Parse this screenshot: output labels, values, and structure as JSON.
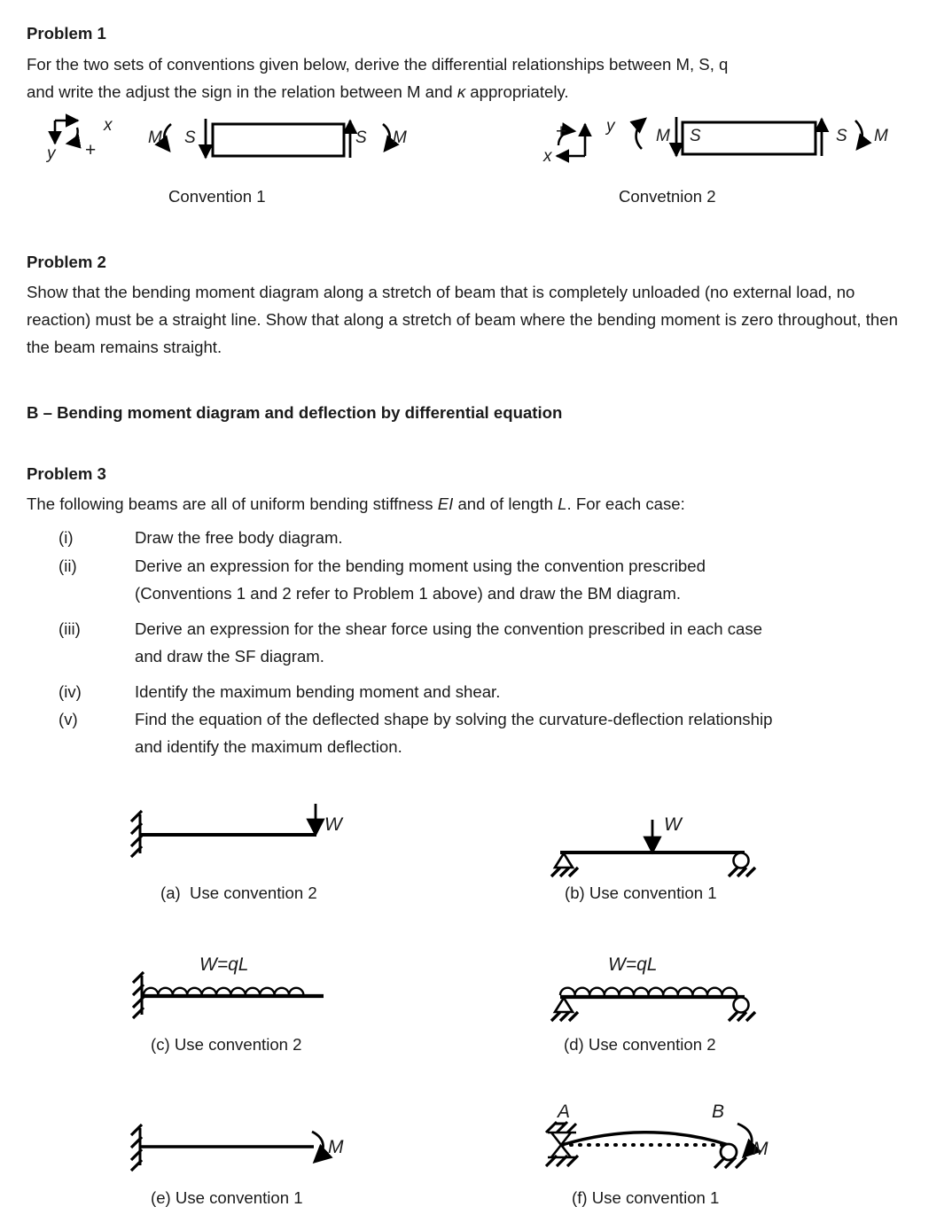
{
  "document": {
    "problem1": {
      "heading": "Problem 1",
      "line1": "For the two sets of conventions given below, derive the differential relationships between M, S, q",
      "line2_a": "and write the adjust the sign in the relation between M and ",
      "line2_kappa": "κ",
      "line2_b": " appropriately."
    },
    "conventions": {
      "one": {
        "caption": "Convention 1",
        "axis_x": "x",
        "axis_y": "y",
        "axis_plus": "+",
        "left_moment": "M",
        "left_shear": "S",
        "right_shear": "S",
        "right_moment": "M"
      },
      "two": {
        "caption": "Convetnion 2",
        "axis_x": "x",
        "axis_y": "y",
        "axis_plus": "+",
        "left_moment": "M",
        "left_shear": "S",
        "right_shear": "S",
        "right_moment": "M"
      }
    },
    "problem2": {
      "heading": "Problem 2",
      "body": "Show that the bending moment diagram along a stretch of beam that is completely unloaded (no external load, no reaction) must be a straight line. Show that along a stretch of beam where the bending moment is zero throughout, then the beam remains straight."
    },
    "sectionB": {
      "heading": "B – Bending moment diagram and deflection by differential equation"
    },
    "problem3": {
      "heading": "Problem 3",
      "intro_a": "The following beams are all of uniform bending stiffness ",
      "intro_EI": "EI",
      "intro_b": " and of length ",
      "intro_L": "L",
      "intro_c": ". For each case:",
      "items": [
        {
          "num": "(i)",
          "lines": [
            "Draw the free body diagram."
          ]
        },
        {
          "num": "(ii)",
          "lines": [
            "Derive an expression for the bending moment using the convention prescribed",
            "(Conventions 1 and 2 refer to Problem 1 above) and draw the BM diagram."
          ]
        },
        {
          "num": "(iii)",
          "lines": [
            "Derive an expression for the shear force using the convention prescribed in each case",
            "and draw the SF diagram."
          ]
        },
        {
          "num": "(iv)",
          "lines": [
            "Identify the maximum bending moment and shear."
          ]
        },
        {
          "num": "(v)",
          "lines": [
            "Find the equation of the deflected shape by solving the curvature-deflection relationship",
            "and identify the maximum deflection."
          ]
        }
      ]
    },
    "beams": {
      "a": {
        "caption": "(a)  Use convention 2",
        "load_label": "W",
        "support_left": "fixed-wall",
        "load_type": "point-load-end"
      },
      "b": {
        "caption": "(b) Use convention 1",
        "load_label": "W",
        "support_left": "pin",
        "support_right": "roller",
        "load_type": "point-load-mid"
      },
      "c": {
        "caption": "(c) Use convention 2",
        "load_label": "W=qL",
        "support_left": "fixed-wall",
        "load_type": "udl"
      },
      "d": {
        "caption": "(d) Use convention 2",
        "load_label": "W=qL",
        "support_left": "pin",
        "support_right": "roller",
        "load_type": "udl"
      },
      "e": {
        "caption": "(e) Use convention 1",
        "load_label": "M",
        "support_left": "fixed-wall",
        "load_type": "end-moment"
      },
      "f": {
        "caption": "(f) Use conventtion 1",
        "caption_actual": "(f) Use convention 1",
        "load_label": "M",
        "node_a": "A",
        "node_b": "B",
        "support_left": "pin-hourglass",
        "support_right": "roller",
        "load_type": "end-moment-deflected"
      }
    },
    "colors": {
      "ink": "#1a1a1a",
      "stroke": "#000000",
      "page": "#ffffff"
    }
  }
}
